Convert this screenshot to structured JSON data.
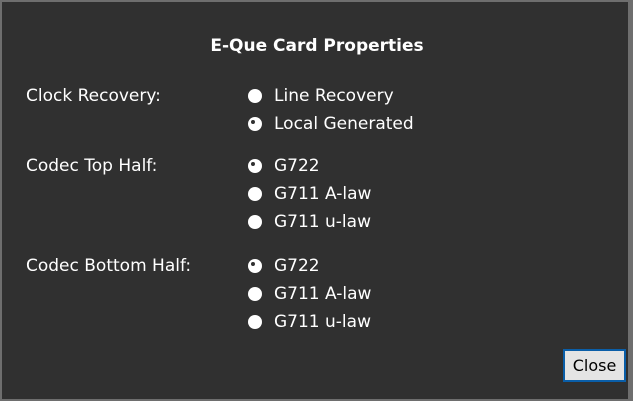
{
  "dialog": {
    "title": "E-Que Card Properties",
    "close_label": "Close"
  },
  "groups": [
    {
      "label": "Clock Recovery:",
      "options": [
        {
          "label": "Line Recovery",
          "selected": false
        },
        {
          "label": "Local Generated",
          "selected": true
        }
      ]
    },
    {
      "label": "Codec Top Half:",
      "options": [
        {
          "label": "G722",
          "selected": true
        },
        {
          "label": "G711 A-law",
          "selected": false
        },
        {
          "label": "G711 u-law",
          "selected": false
        }
      ]
    },
    {
      "label": "Codec Bottom Half:",
      "options": [
        {
          "label": "G722",
          "selected": true
        },
        {
          "label": "G711 A-law",
          "selected": false
        },
        {
          "label": "G711 u-law",
          "selected": false
        }
      ]
    }
  ],
  "colors": {
    "background": "#303030",
    "border": "#6e6e6e",
    "text": "#ffffff",
    "button_border": "#0a5ea8"
  }
}
